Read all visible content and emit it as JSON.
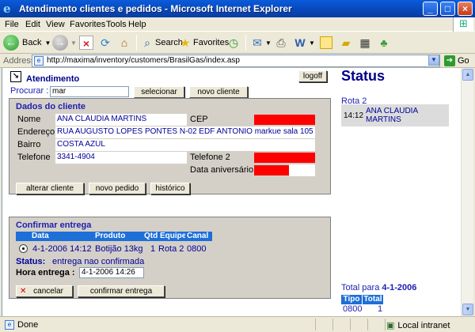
{
  "window": {
    "title": "Atendimento clientes e pedidos - Microsoft Internet Explorer",
    "controls": [
      "_",
      "□",
      "×"
    ]
  },
  "menu": [
    "File",
    "Edit",
    "View",
    "Favorites",
    "Tools",
    "Help"
  ],
  "toolbar": {
    "back": "Back",
    "search": "Search",
    "favorites": "Favorites"
  },
  "address": {
    "label": "Address",
    "url": "http://maxima/inventory/customers/BrasilGas/index.asp",
    "go": "Go"
  },
  "page": {
    "title": "Atendimento",
    "logoff": "logoff",
    "search_label": "Procurar :",
    "search_value": "mar",
    "select_btn": "selecionar",
    "new_client_btn": "novo cliente",
    "client_panel": {
      "title": "Dados do cliente",
      "fields": {
        "nome_label": "Nome",
        "nome_value": "ANA CLAUDIA MARTINS",
        "cep_label": "CEP",
        "endereco_label": "Endereço",
        "endereco_value": "RUA AUGUSTO LOPES PONTES N-02 EDF ANTONIO markue sala 105",
        "bairro_label": "Bairro",
        "bairro_value": "COSTA AZUL",
        "telefone_label": "Telefone",
        "telefone_value": "3341-4904",
        "telefone2_label": "Telefone 2",
        "aniversario_label": "Data aniversário"
      },
      "buttons": {
        "alterar": "alterar cliente",
        "novo_pedido": "novo pedido",
        "historico": "histórico"
      }
    },
    "delivery_panel": {
      "title": "Confirmar entrega",
      "columns": [
        "Data",
        "Produto",
        "Qtd",
        "Equipe",
        "Canal"
      ],
      "row": {
        "data": "4-1-2006 14:12",
        "produto": "Botijão 13kg",
        "qtd": "1",
        "equipe": "Rota 2",
        "canal": "0800"
      },
      "status_label": "Status:",
      "status_value": "entrega nao confirmada",
      "hora_label": "Hora entrega :",
      "hora_value": "4-1-2006 14:26",
      "cancel_btn": "cancelar",
      "confirm_btn": "confirmar entrega"
    },
    "status_panel": {
      "title": "Status",
      "rota": "Rota 2",
      "entry_time": "14:12",
      "entry_name": "ANA CLAUDIA MARTINS",
      "total_label": "Total para",
      "total_date": "4-1-2006",
      "total_columns": [
        "Tipo",
        "Total"
      ],
      "total_row": [
        "0800",
        "1"
      ]
    }
  },
  "statusbar": {
    "done": "Done",
    "zone": "Local intranet"
  }
}
